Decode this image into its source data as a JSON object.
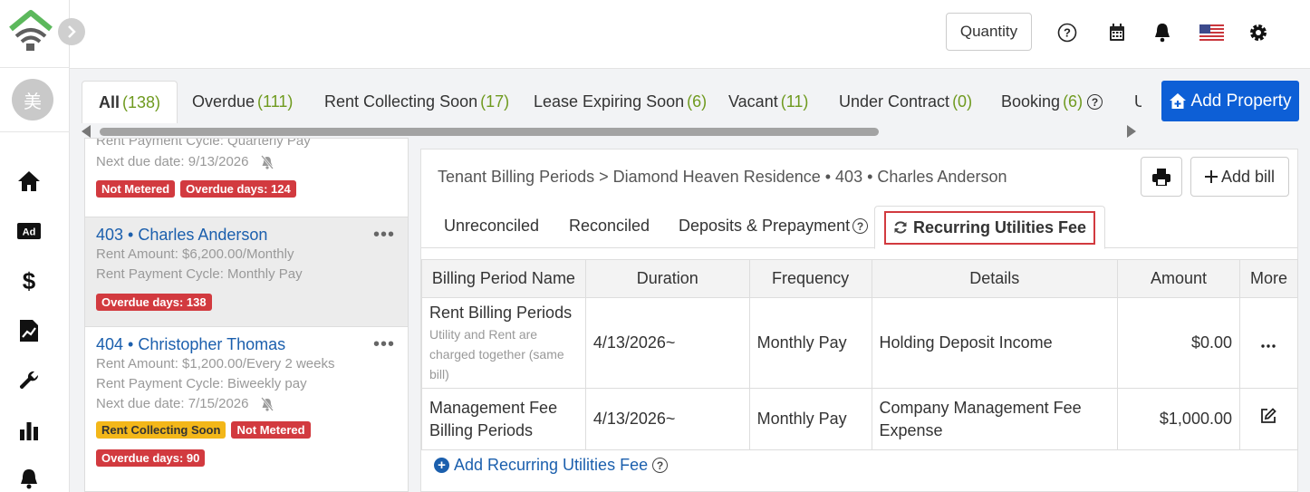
{
  "rail": {
    "avatar_text": "美",
    "icons": [
      "home-icon",
      "ad-icon",
      "dollar-icon",
      "report-icon",
      "wrench-icon",
      "bar-chart-icon",
      "bell-icon"
    ]
  },
  "header": {
    "quantity_label": "Quantity",
    "icons": [
      "help-icon",
      "calendar-icon",
      "bell-icon",
      "us-flag-icon",
      "gear-icon"
    ]
  },
  "status_tabs": [
    {
      "label": "All",
      "count": "(138)"
    },
    {
      "label": "Overdue",
      "count": "(111)"
    },
    {
      "label": "Rent Collecting Soon",
      "count": "(17)"
    },
    {
      "label": "Lease Expiring Soon",
      "count": "(6)"
    },
    {
      "label": "Vacant",
      "count": "(11)"
    },
    {
      "label": "Under Contract",
      "count": "(0)"
    },
    {
      "label": "Booking",
      "count": "(6)"
    },
    {
      "label": "U",
      "count": ""
    }
  ],
  "add_property_label": "Add Property",
  "tenants": [
    {
      "partial_line": "Rent Payment Cycle: Quarterly Pay",
      "due": "Next due date:  9/13/2026",
      "badges": [
        "Not Metered",
        "Overdue days: 124"
      ]
    },
    {
      "unit": "403",
      "name": "Charles Anderson",
      "rent": "Rent Amount: $6,200.00/Monthly",
      "cycle": "Rent Payment Cycle: Monthly Pay",
      "badges": [
        "Overdue days: 138"
      ]
    },
    {
      "unit": "404",
      "name": "Christopher Thomas",
      "rent": "Rent Amount: $1,200.00/Every 2 weeks",
      "cycle": "Rent Payment Cycle: Biweekly pay",
      "due": "Next due date:  7/15/2026",
      "badges": [
        "Rent Collecting Soon",
        "Not Metered",
        "Overdue days: 90"
      ]
    }
  ],
  "panel": {
    "breadcrumb": "Tenant Billing Periods >  Diamond Heaven Residence • 403 • Charles Anderson",
    "add_bill_label": "Add bill",
    "tabs": [
      "Unreconciled",
      "Reconciled",
      "Deposits & Prepayment",
      "Recurring Utilities Fee"
    ],
    "table": {
      "headers": [
        "Billing Period Name",
        "Duration",
        "Frequency",
        "Details",
        "Amount",
        "More"
      ],
      "rows": [
        {
          "name": "Rent Billing Periods",
          "note": "Utility and Rent are charged together (same bill)",
          "duration": "4/13/2026~",
          "frequency": "Monthly Pay",
          "details": "Holding Deposit Income",
          "amount": "$0.00"
        },
        {
          "name": "Management Fee Billing Periods",
          "duration": "4/13/2026~",
          "frequency": "Monthly Pay",
          "details": "Company Management Fee Expense",
          "amount": "$1,000.00"
        }
      ]
    },
    "add_recurring_label": "Add Recurring Utilities Fee"
  }
}
